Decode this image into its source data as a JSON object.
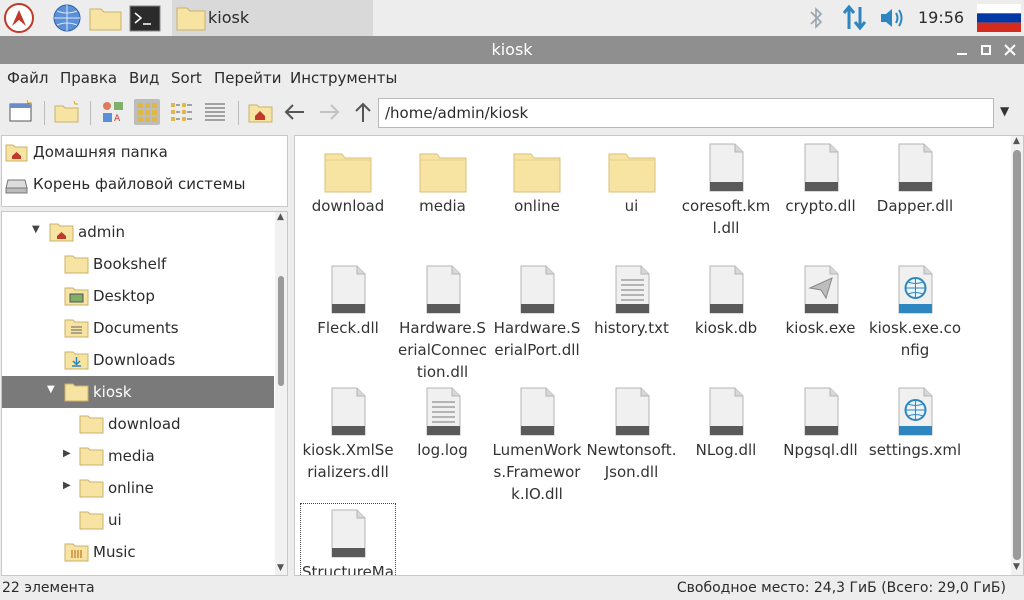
{
  "taskbar": {
    "task_label": "kiosk",
    "clock": "19:56"
  },
  "window": {
    "title": "kiosk"
  },
  "menu": [
    "Файл",
    "Правка",
    "Вид",
    "Sort",
    "Перейти",
    "Инструменты"
  ],
  "toolbar": {
    "path": "/home/admin/kiosk"
  },
  "places": [
    {
      "label": "Домашняя папка",
      "icon": "home-folder-icon"
    },
    {
      "label": "Корень файловой системы",
      "icon": "drive-icon"
    }
  ],
  "tree": [
    {
      "label": "admin",
      "icon": "home-folder-icon",
      "expander": "expanded"
    },
    {
      "label": "Bookshelf",
      "icon": "folder-icon"
    },
    {
      "label": "Desktop",
      "icon": "desktop-folder-icon"
    },
    {
      "label": "Documents",
      "icon": "documents-folder-icon"
    },
    {
      "label": "Downloads",
      "icon": "downloads-folder-icon"
    },
    {
      "label": "kiosk",
      "icon": "folder-icon",
      "expander": "expanded",
      "selected": true
    },
    {
      "label": "download",
      "icon": "folder-icon"
    },
    {
      "label": "media",
      "icon": "folder-icon",
      "expander": "collapsed"
    },
    {
      "label": "online",
      "icon": "folder-icon",
      "expander": "collapsed"
    },
    {
      "label": "ui",
      "icon": "folder-icon"
    },
    {
      "label": "Music",
      "icon": "music-folder-icon"
    }
  ],
  "files": [
    {
      "name": "download",
      "icon": "folder-icon"
    },
    {
      "name": "media",
      "icon": "folder-icon"
    },
    {
      "name": "online",
      "icon": "folder-icon"
    },
    {
      "name": "ui",
      "icon": "folder-icon"
    },
    {
      "name": "coresoft.kml.dll",
      "icon": "file-icon"
    },
    {
      "name": "crypto.dll",
      "icon": "file-icon"
    },
    {
      "name": "Dapper.dll",
      "icon": "file-icon"
    },
    {
      "name": "Fleck.dll",
      "icon": "file-icon"
    },
    {
      "name": "Hardware.SerialConnection.dll",
      "icon": "file-icon"
    },
    {
      "name": "Hardware.SerialPort.dll",
      "icon": "file-icon"
    },
    {
      "name": "history.txt",
      "icon": "text-file-icon"
    },
    {
      "name": "kiosk.db",
      "icon": "file-icon"
    },
    {
      "name": "kiosk.exe",
      "icon": "executable-icon"
    },
    {
      "name": "kiosk.exe.config",
      "icon": "web-file-icon"
    },
    {
      "name": "kiosk.XmlSerializers.dll",
      "icon": "file-icon"
    },
    {
      "name": "log.log",
      "icon": "text-file-icon"
    },
    {
      "name": "LumenWorks.Framework.IO.dll",
      "icon": "file-icon"
    },
    {
      "name": "Newtonsoft.Json.dll",
      "icon": "file-icon"
    },
    {
      "name": "NLog.dll",
      "icon": "file-icon"
    },
    {
      "name": "Npgsql.dll",
      "icon": "file-icon"
    },
    {
      "name": "settings.xml",
      "icon": "web-file-icon"
    },
    {
      "name": "StructureMap.dll",
      "icon": "file-icon",
      "focused": true
    }
  ],
  "status": {
    "count": "22 элемента",
    "free_space": "Свободное место: 24,3 ГиБ (Всего: 29,0 ГиБ)"
  }
}
